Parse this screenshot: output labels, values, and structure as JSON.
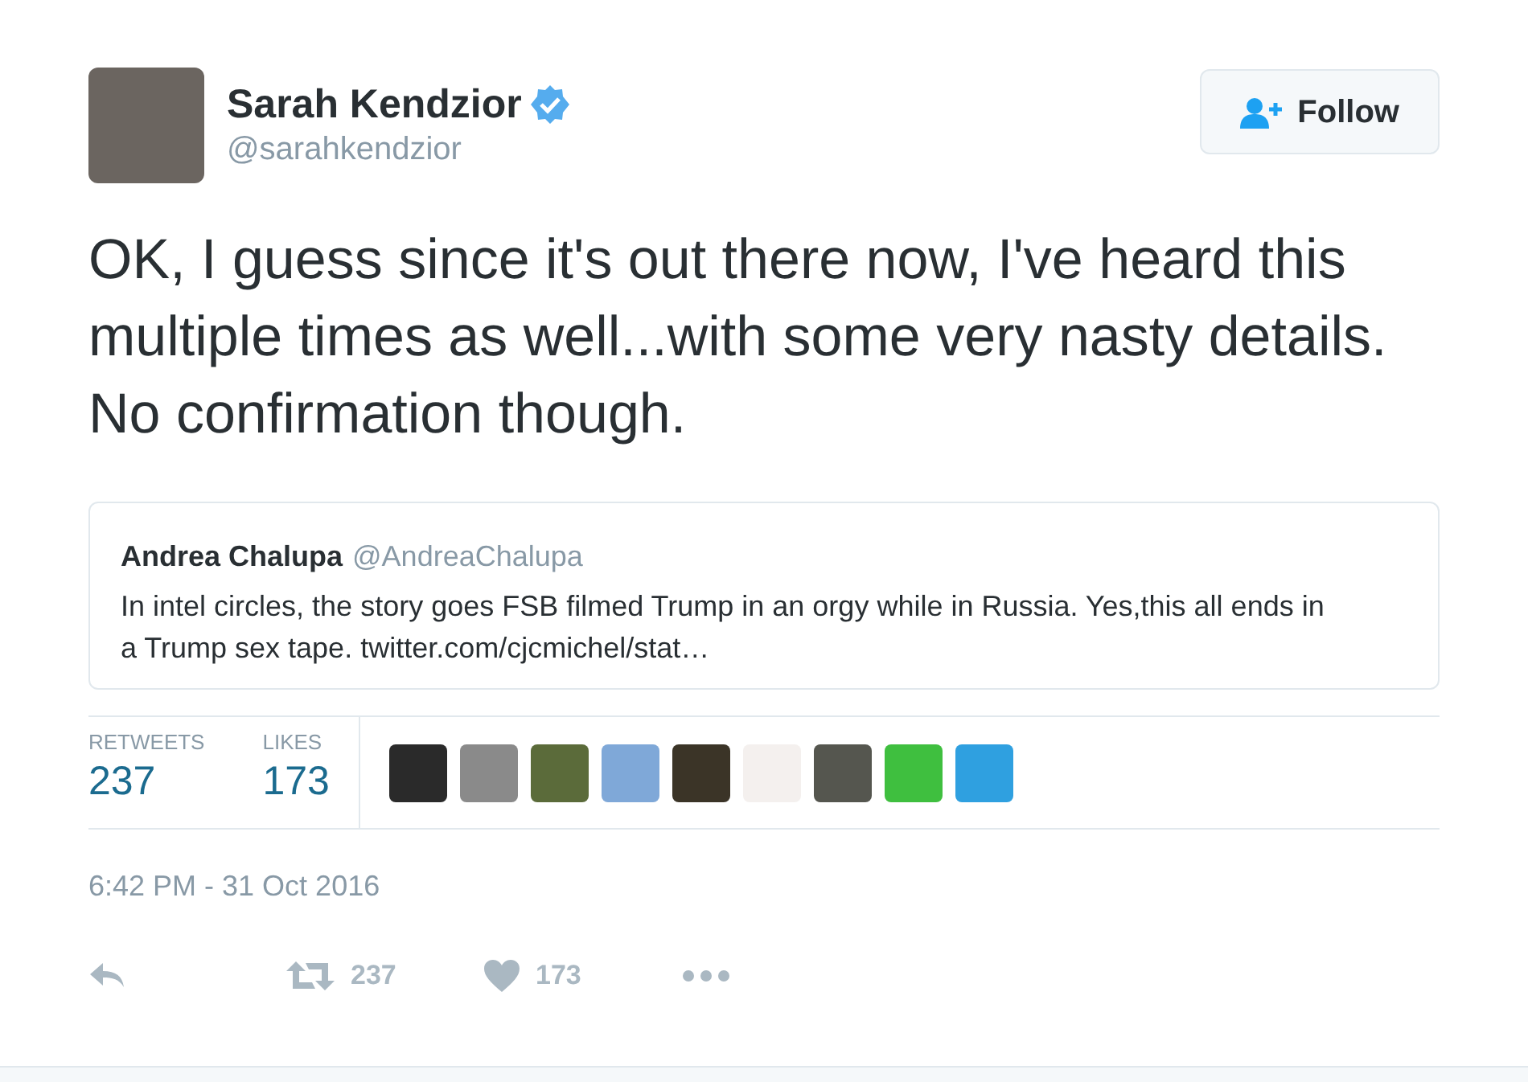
{
  "author": {
    "name": "Sarah Kendzior",
    "handle": "@sarahkendzior",
    "verified": true
  },
  "follow_button": {
    "label": "Follow"
  },
  "tweet_text": "OK, I guess since it's out there now, I've heard this multiple times as well...with some very nasty details. No confirmation though.",
  "quoted_tweet": {
    "name": "Andrea Chalupa",
    "handle": "@AndreaChalupa",
    "text": "In intel circles, the story goes FSB filmed Trump in an orgy while in Russia. Yes,this all ends in a Trump sex tape. twitter.com/cjcmichel/stat…"
  },
  "stats": [
    {
      "label": "RETWEETS",
      "value": "237"
    },
    {
      "label": "LIKES",
      "value": "173"
    }
  ],
  "timestamp": "6:42 PM - 31 Oct 2016",
  "actions": [
    {
      "kind": "reply"
    },
    {
      "kind": "retweet",
      "count": "237"
    },
    {
      "kind": "like",
      "count": "173"
    },
    {
      "kind": "more"
    }
  ]
}
